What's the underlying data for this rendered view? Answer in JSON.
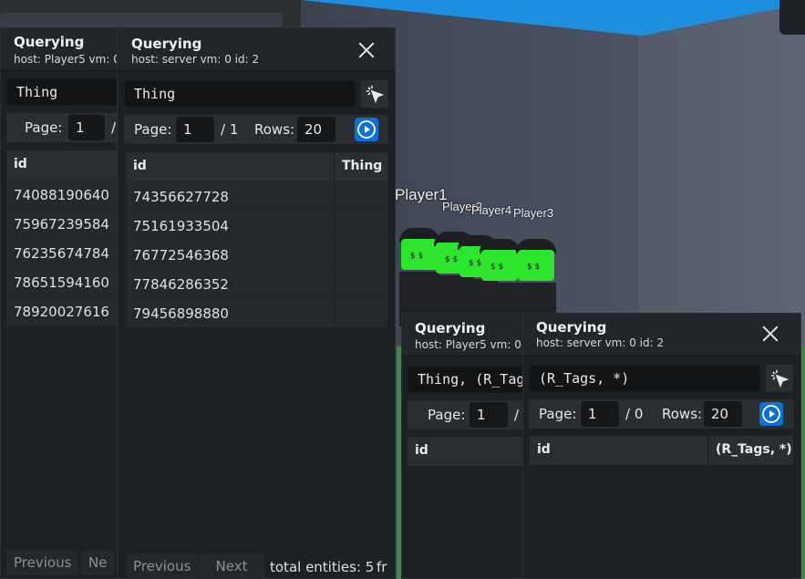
{
  "scene": {
    "players": [
      "Player1",
      "Player2",
      "Player4",
      "Player3"
    ],
    "avatar_face": "$ $"
  },
  "windows": [
    {
      "title": "Querying",
      "subtitle": "host: Player5 vm: 0",
      "query": "Thing",
      "page_label": "Page:",
      "page_value": "1",
      "page_total": "/",
      "columns": [
        "id"
      ],
      "rows": [
        "74088190640",
        "75967239584",
        "76235674784",
        "78651594160",
        "78920027616"
      ],
      "prev_label": "Previous",
      "next_label": "Ne"
    },
    {
      "title": "Querying",
      "subtitle": "host: server vm: 0 id: 2",
      "query": "Thing",
      "page_label": "Page:",
      "page_value": "1",
      "page_total": "/ 1",
      "rows_label": "Rows:",
      "rows_value": "20",
      "columns": [
        "id",
        "Thing"
      ],
      "rows": [
        "74356627728",
        "75161933504",
        "76772546368",
        "77846286352",
        "79456898880"
      ],
      "prev_label": "Previous",
      "next_label": "Next",
      "total_text": "total entities: 5",
      "extra_text": "fr"
    },
    {
      "title": "Querying",
      "subtitle": "host: Player5 vm: 0",
      "query": "Thing, (R_Tag",
      "page_label": "Page:",
      "page_value": "1",
      "page_total": "/",
      "columns": [
        "id"
      ]
    },
    {
      "title": "Querying",
      "subtitle": "host: server vm: 0 id: 2",
      "query": "(R_Tags, *)",
      "page_label": "Page:",
      "page_value": "1",
      "page_total": "/ 0",
      "rows_label": "Rows:",
      "rows_value": "20",
      "columns": [
        "id",
        "(R_Tags, *)"
      ]
    }
  ],
  "colors": {
    "accent": "#0d6fd8",
    "avatar_head": "#2ee52e",
    "panel": "#1e2123"
  }
}
